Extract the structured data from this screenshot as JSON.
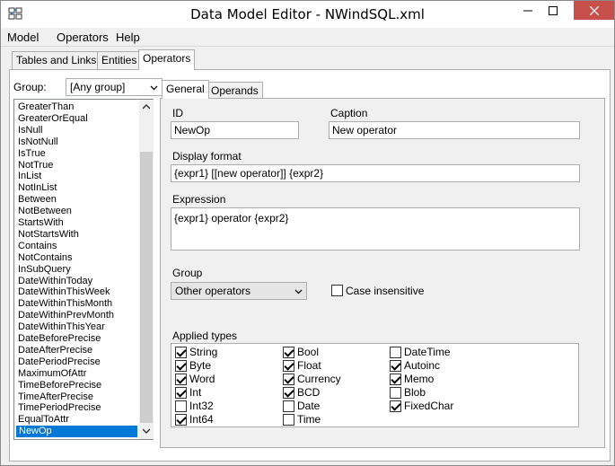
{
  "window": {
    "title": "Data Model Editor - NWindSQL.xml",
    "icons": {
      "app": "data-model-icon",
      "minimize": "minimize-icon",
      "maximize": "maximize-icon",
      "close": "close-icon"
    },
    "colors": {
      "close_button": "#c7504b",
      "selection": "#0078d7"
    }
  },
  "menu": {
    "items": [
      "Model",
      "Operators",
      "Help"
    ]
  },
  "tabs": {
    "items": [
      "Tables and Links",
      "Entities",
      "Operators"
    ],
    "active": "Operators"
  },
  "left": {
    "group_label": "Group:",
    "group_value": "[Any group]",
    "operators": [
      "GreaterThan",
      "GreaterOrEqual",
      "IsNull",
      "IsNotNull",
      "IsTrue",
      "NotTrue",
      "InList",
      "NotInList",
      "Between",
      "NotBetween",
      "StartsWith",
      "NotStartsWith",
      "Contains",
      "NotContains",
      "InSubQuery",
      "DateWithinToday",
      "DateWithinThisWeek",
      "DateWithinThisMonth",
      "DateWithinPrevMonth",
      "DateWithinThisYear",
      "DateBeforePrecise",
      "DateAfterPrecise",
      "DatePeriodPrecise",
      "MaximumOfAttr",
      "TimeBeforePrecise",
      "TimeAfterPrecise",
      "TimePeriodPrecise",
      "EqualToAttr",
      "NewOp"
    ],
    "selected": "NewOp"
  },
  "inner_tabs": {
    "items": [
      "General",
      "Operands"
    ],
    "active": "General"
  },
  "form": {
    "id_label": "ID",
    "id_value": "NewOp",
    "caption_label": "Caption",
    "caption_value": "New operator",
    "display_format_label": "Display format",
    "display_format_value": "{expr1} [[new operator]] {expr2}",
    "expression_label": "Expression",
    "expression_value": "{expr1} operator {expr2}",
    "group_label": "Group",
    "group_value": "Other operators",
    "case_insensitive_label": "Case insensitive",
    "case_insensitive_checked": false,
    "applied_types_label": "Applied types",
    "applied_types": [
      [
        {
          "label": "String",
          "checked": true
        },
        {
          "label": "Bool",
          "checked": true
        },
        {
          "label": "DateTime",
          "checked": false
        }
      ],
      [
        {
          "label": "Byte",
          "checked": true
        },
        {
          "label": "Float",
          "checked": true
        },
        {
          "label": "Autoinc",
          "checked": true
        }
      ],
      [
        {
          "label": "Word",
          "checked": true
        },
        {
          "label": "Currency",
          "checked": true
        },
        {
          "label": "Memo",
          "checked": true
        }
      ],
      [
        {
          "label": "Int",
          "checked": true
        },
        {
          "label": "BCD",
          "checked": true
        },
        {
          "label": "Blob",
          "checked": false
        }
      ],
      [
        {
          "label": "Int32",
          "checked": false
        },
        {
          "label": "Date",
          "checked": false
        },
        {
          "label": "FixedChar",
          "checked": true
        }
      ],
      [
        {
          "label": "Int64",
          "checked": true
        },
        {
          "label": "Time",
          "checked": false
        }
      ]
    ]
  }
}
